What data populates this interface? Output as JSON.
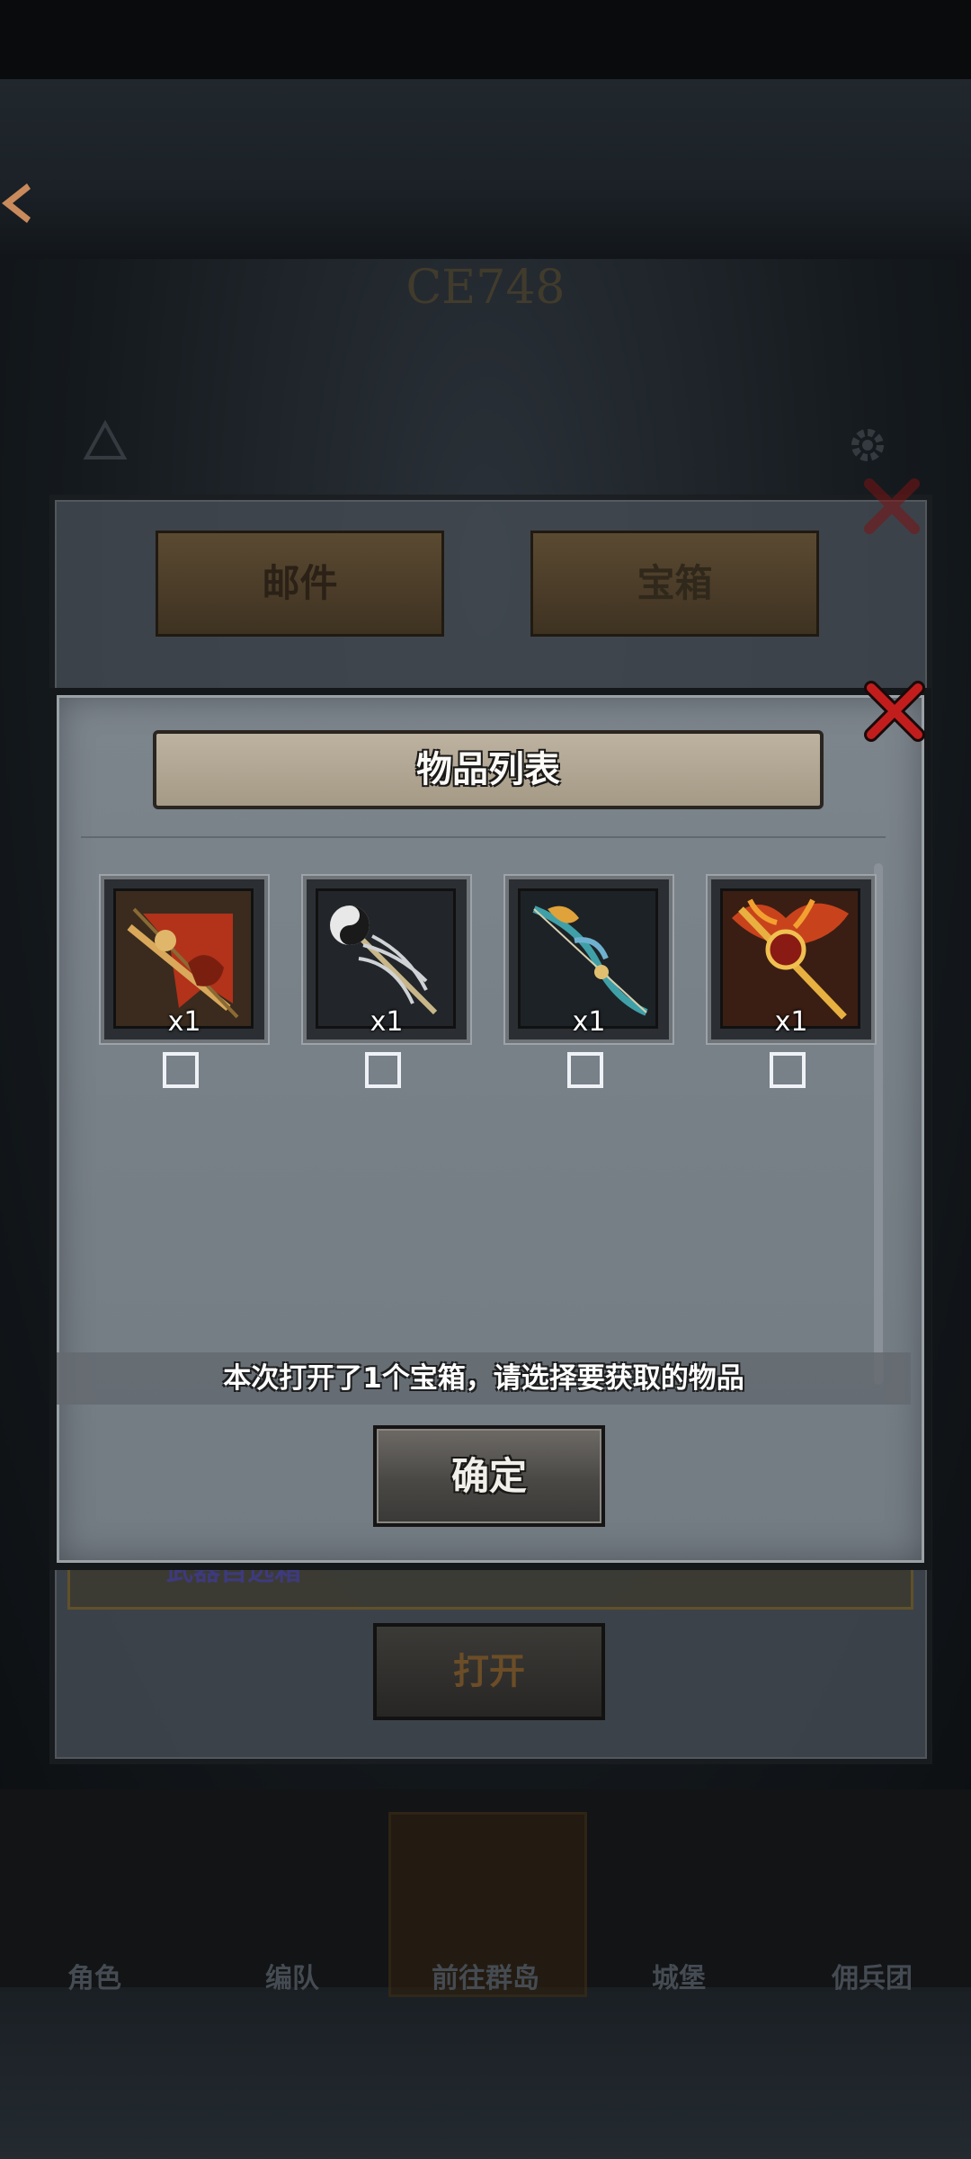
{
  "background": {
    "banner_text": "CE748",
    "mail_tabs": [
      "邮件",
      "宝箱"
    ],
    "row_text": "武器自选箱",
    "open_button": "打开",
    "nav_items": [
      "角色",
      "编队",
      "前往群岛",
      "城堡",
      "佣兵团"
    ]
  },
  "dialog": {
    "title": "物品列表",
    "items": [
      {
        "icon": "banner-weapon-icon",
        "qty": "x1",
        "checked": false
      },
      {
        "icon": "yinyang-staff-icon",
        "qty": "x1",
        "checked": false
      },
      {
        "icon": "ornate-bow-icon",
        "qty": "x1",
        "checked": false
      },
      {
        "icon": "flame-trident-icon",
        "qty": "x1",
        "checked": false
      }
    ],
    "info": "本次打开了1个宝箱，请选择要获取的物品",
    "confirm_label": "确定"
  }
}
